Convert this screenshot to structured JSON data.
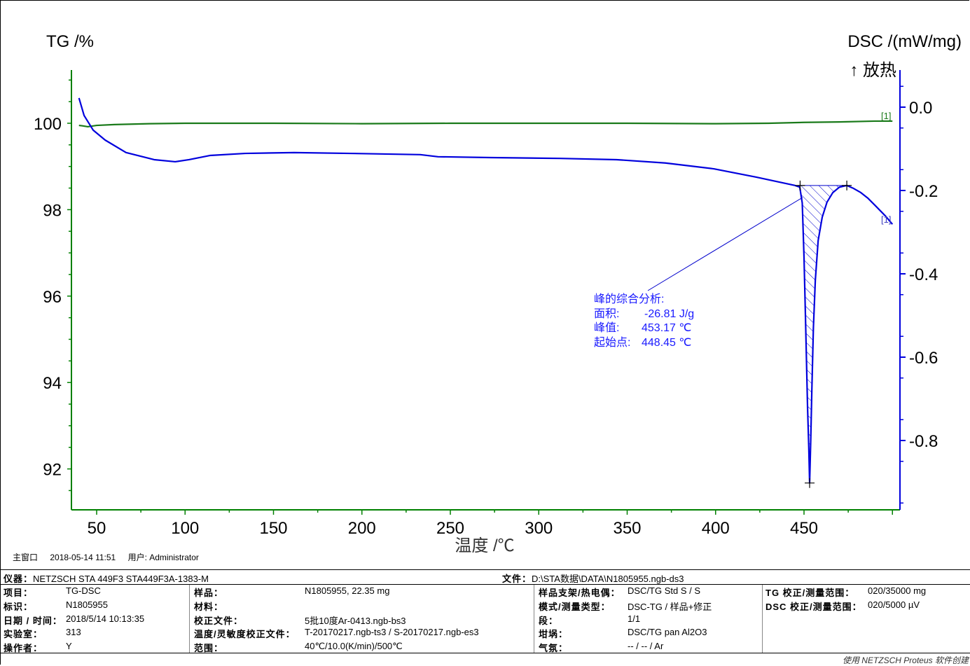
{
  "chart_data": {
    "type": "line",
    "left_axis": {
      "label": "TG /%",
      "ylim": [
        91.04,
        101.23
      ],
      "ticks": [
        100,
        98,
        96,
        94,
        92
      ],
      "color": "#008000"
    },
    "right_axis": {
      "label": "DSC /(mW/mg)",
      "exo_label": "↑ 放热",
      "ylim": [
        -0.966,
        0.089
      ],
      "ticks": [
        "0.0",
        "-0.2",
        "-0.4",
        "-0.6",
        "-0.8"
      ],
      "tick_values": [
        0,
        -0.2,
        -0.4,
        -0.6,
        -0.8
      ],
      "color": "#0000dd"
    },
    "x_axis": {
      "label": "温度 /℃",
      "xlim": [
        35.7,
        504
      ],
      "ticks": [
        50,
        100,
        150,
        200,
        250,
        300,
        350,
        400,
        450
      ]
    },
    "series": [
      {
        "name": "TG",
        "tag": "[1]",
        "axis": "left",
        "color": "#1a7a1a",
        "points": [
          [
            40,
            99.95
          ],
          [
            42,
            99.94
          ],
          [
            45,
            99.92
          ],
          [
            50,
            99.95
          ],
          [
            60,
            99.97
          ],
          [
            80,
            99.99
          ],
          [
            100,
            100.0
          ],
          [
            150,
            100.0
          ],
          [
            200,
            99.99
          ],
          [
            250,
            100.0
          ],
          [
            300,
            100.0
          ],
          [
            350,
            100.0
          ],
          [
            400,
            99.99
          ],
          [
            430,
            100.0
          ],
          [
            450,
            100.02
          ],
          [
            470,
            100.03
          ],
          [
            490,
            100.05
          ],
          [
            500,
            100.05
          ]
        ]
      },
      {
        "name": "DSC",
        "tag": "[1]",
        "axis": "right",
        "color": "#0000dd",
        "points": [
          [
            40,
            0.022
          ],
          [
            42.9,
            -0.02
          ],
          [
            48,
            -0.055
          ],
          [
            54.8,
            -0.079
          ],
          [
            66.6,
            -0.109
          ],
          [
            82.5,
            -0.126
          ],
          [
            94.4,
            -0.131
          ],
          [
            102.3,
            -0.126
          ],
          [
            114,
            -0.116
          ],
          [
            134,
            -0.111
          ],
          [
            161.7,
            -0.109
          ],
          [
            193.4,
            -0.111
          ],
          [
            233,
            -0.114
          ],
          [
            243,
            -0.119
          ],
          [
            272.6,
            -0.121
          ],
          [
            312,
            -0.123
          ],
          [
            343.9,
            -0.126
          ],
          [
            371.6,
            -0.134
          ],
          [
            399,
            -0.148
          ],
          [
            423,
            -0.168
          ],
          [
            444.9,
            -0.188
          ],
          [
            447.6,
            -0.192
          ],
          [
            449,
            -0.23
          ],
          [
            450,
            -0.36
          ],
          [
            450.8,
            -0.5
          ],
          [
            452,
            -0.72
          ],
          [
            452.7,
            -0.818
          ],
          [
            453.17,
            -0.902
          ],
          [
            453.8,
            -0.8
          ],
          [
            454.4,
            -0.684
          ],
          [
            455.3,
            -0.53
          ],
          [
            456.4,
            -0.415
          ],
          [
            458,
            -0.32
          ],
          [
            460.3,
            -0.264
          ],
          [
            463,
            -0.228
          ],
          [
            466.3,
            -0.205
          ],
          [
            470,
            -0.192
          ],
          [
            474.2,
            -0.188
          ],
          [
            478,
            -0.195
          ],
          [
            482.1,
            -0.205
          ],
          [
            486,
            -0.218
          ],
          [
            490,
            -0.235
          ],
          [
            496,
            -0.261
          ],
          [
            500,
            -0.281
          ]
        ]
      }
    ],
    "peak_analysis": {
      "title": "峰的综合分析:",
      "area_label": "面积:",
      "area_value": "-26.81 J/g",
      "peak_label": "峰值:",
      "peak_value": "453.17 ℃",
      "onset_label": "起始点:",
      "onset_value": "448.45 ℃",
      "baseline_start": 447.0,
      "baseline_end": 474.2,
      "baseline_value": -0.188,
      "peak_T": 453.17,
      "peak_y": -0.902
    }
  },
  "status": {
    "window": "主窗口",
    "datetime": "2018-05-14 11:51",
    "user": "用户: Administrator"
  },
  "header": {
    "instrument_label": "仪器：",
    "instrument": "NETZSCH STA 449F3 STA449F3A-1383-M",
    "file_label": "文件：",
    "file": "D:\\STA数据\\DATA\\N1805955.ngb-ds3"
  },
  "table": {
    "col1": [
      [
        "项目：",
        "TG-DSC"
      ],
      [
        "标识：",
        "N1805955"
      ],
      [
        "日期 / 时间：",
        "2018/5/14 10:13:35"
      ],
      [
        "实验室：",
        "313"
      ],
      [
        "操作者：",
        "Y"
      ]
    ],
    "col2": [
      [
        "样品：",
        "N1805955, 22.35 mg"
      ],
      [
        "材料：",
        ""
      ],
      [
        "校正文件：",
        "5批10度Ar-0413.ngb-bs3"
      ],
      [
        "温度/灵敏度校正文件：",
        "T-20170217.ngb-ts3 / S-20170217.ngb-es3"
      ],
      [
        "范围：",
        "40℃/10.0(K/min)/500℃"
      ]
    ],
    "col3": [
      [
        "样品支架/热电偶：",
        "DSC/TG Std S / S"
      ],
      [
        "模式/测量类型：",
        "DSC-TG / 样品+修正"
      ],
      [
        "段：",
        "1/1"
      ],
      [
        "坩埚：",
        "DSC/TG pan Al2O3"
      ],
      [
        "气氛：",
        "-- / -- / Ar"
      ]
    ],
    "col4": [
      [
        "TG 校正/测量范围：",
        "020/35000 mg"
      ],
      [
        "DSC 校正/测量范围：",
        "020/5000 µV"
      ]
    ]
  },
  "footer": "使用 NETZSCH Proteus 软件创建"
}
